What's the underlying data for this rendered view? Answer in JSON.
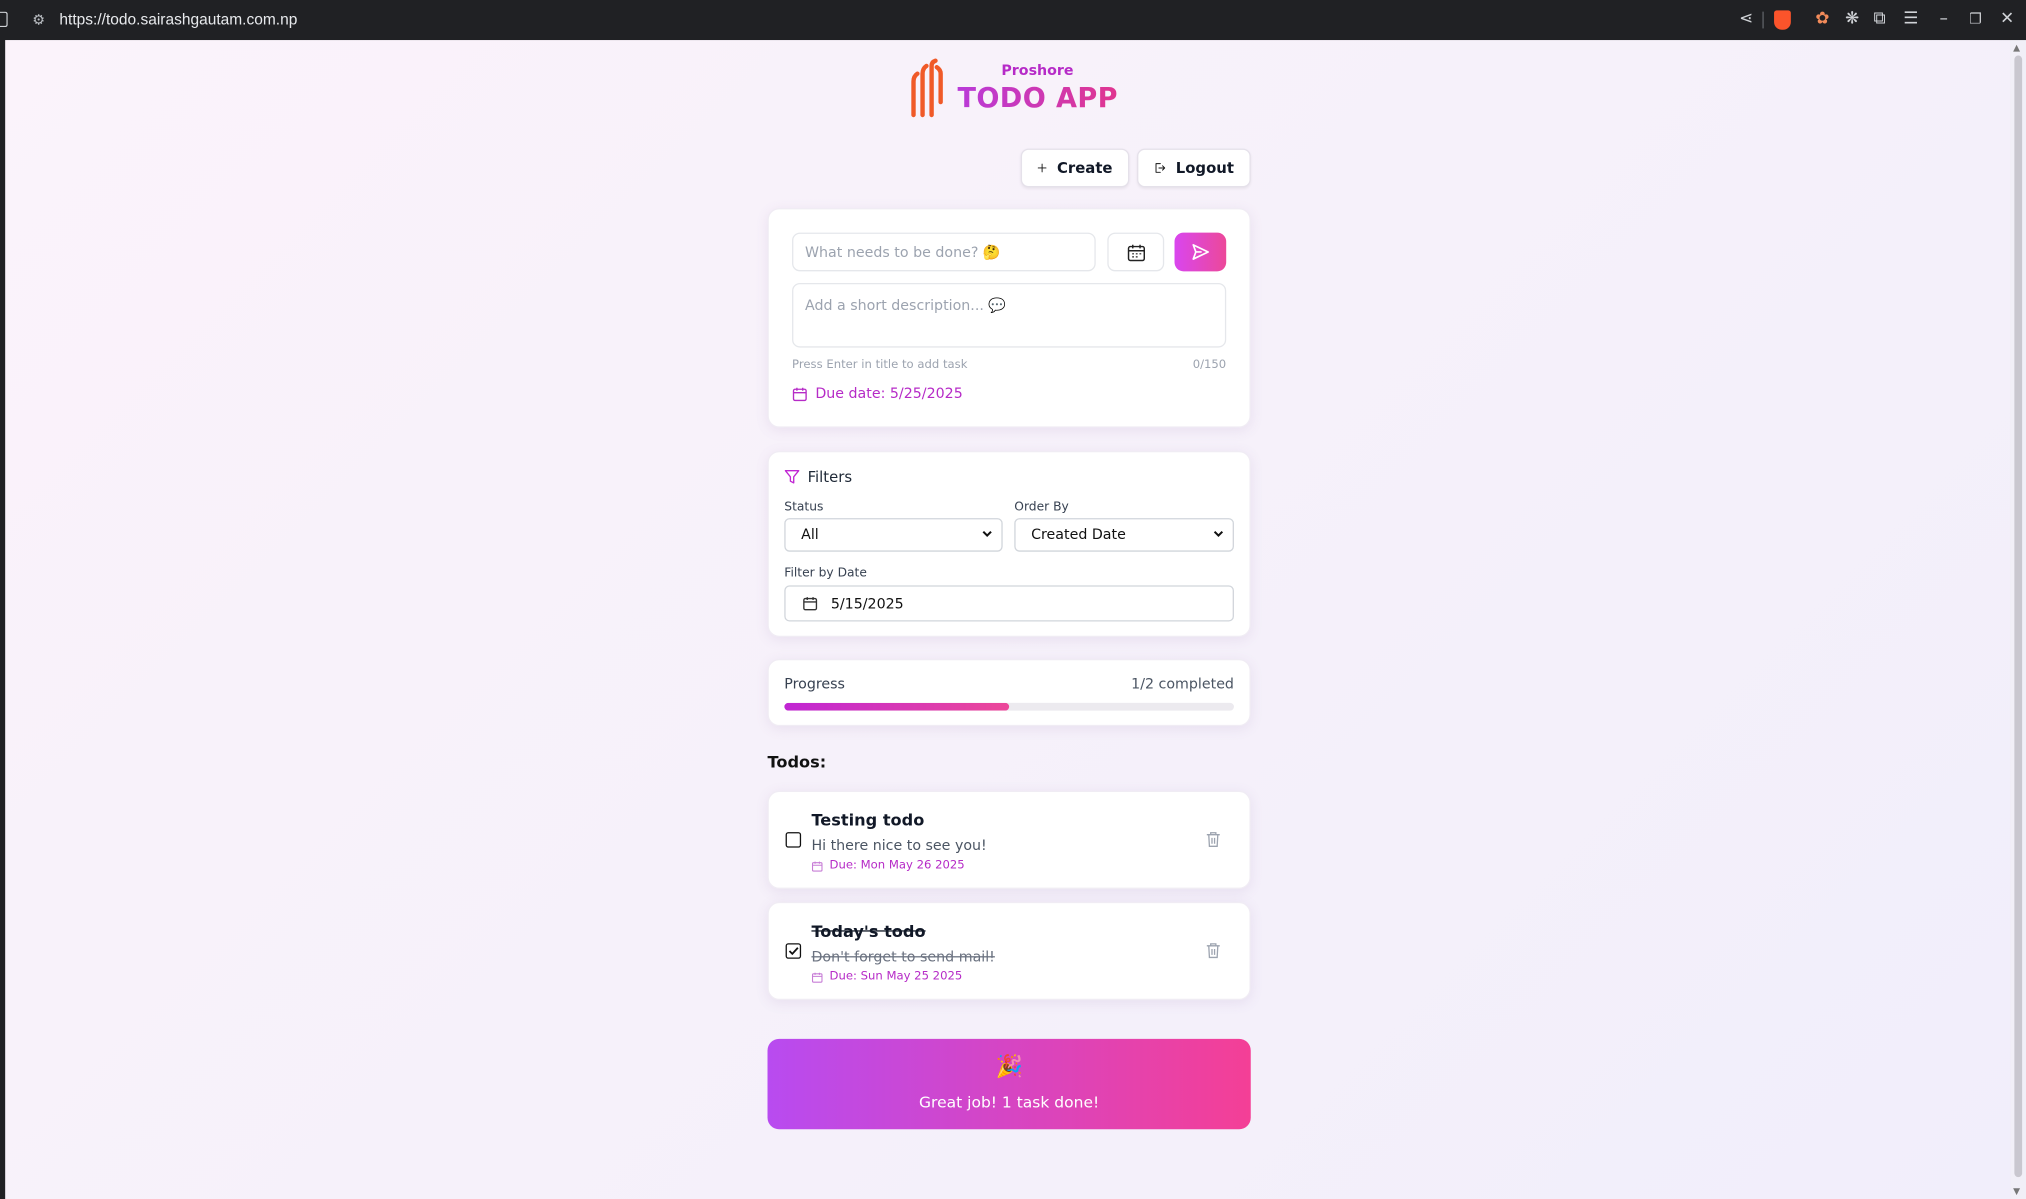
{
  "browser": {
    "url": "https://todo.sairashgautam.com.np"
  },
  "brand": {
    "subtitle": "Proshore",
    "title": "TODO APP"
  },
  "toolbar": {
    "create_label": "Create",
    "logout_label": "Logout"
  },
  "new_task": {
    "title_placeholder": "What needs to be done? 🤔",
    "description_placeholder": "Add a short description... 💬",
    "hint": "Press Enter in title to add task",
    "char_count": "0/150",
    "due_date": "Due date: 5/25/2025"
  },
  "filters": {
    "heading": "Filters",
    "status_label": "Status",
    "status_value": "All",
    "order_label": "Order By",
    "order_value": "Created Date",
    "date_label": "Filter by Date",
    "date_value": "5/15/2025"
  },
  "progress": {
    "label": "Progress",
    "summary": "1/2 completed",
    "fraction": 0.5
  },
  "todos": {
    "heading": "Todos:",
    "items": [
      {
        "title": "Testing todo",
        "description": "Hi there nice to see you!",
        "due": "Due: Mon May 26 2025",
        "completed": false
      },
      {
        "title": "Today's todo",
        "description": "Don't forget to send mail!",
        "due": "Due: Sun May 25 2025",
        "completed": true
      }
    ]
  },
  "banner": {
    "emoji": "🎉",
    "message": "Great job! 1 task done!"
  },
  "colors": {
    "accent": "#c026d3",
    "accent_pink": "#ec4899",
    "logo_orange": "#f05a28"
  }
}
